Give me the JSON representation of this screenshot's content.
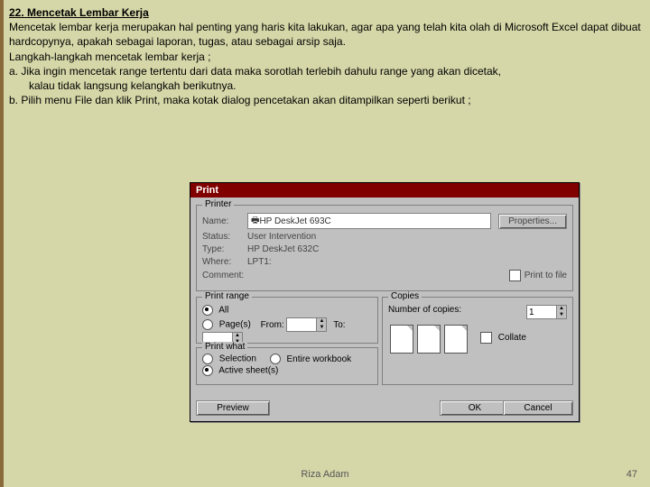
{
  "doc": {
    "heading": "22. Mencetak Lembar Kerja",
    "p1": "Mencetak lembar kerja merupakan hal penting yang haris kita lakukan, agar apa yang telah kita olah di Microsoft Excel dapat dibuat hardcopynya, apakah sebagai laporan, tugas, atau sebagai arsip saja.",
    "p2": "Langkah-langkah mencetak lembar kerja ;",
    "p3": "a. Jika ingin mencetak range tertentu dari data maka sorotlah terlebih dahulu range yang akan dicetak,",
    "p3b": "kalau tidak langsung kelangkah berikutnya.",
    "p4": "b. Pilih menu File dan klik Print, maka kotak dialog pencetakan akan ditampilkan seperti berikut ;"
  },
  "dialog": {
    "title": "Print",
    "printer": {
      "box": "Printer",
      "name_label": "Name:",
      "name_value": "HP DeskJet 693C",
      "status_label": "Status:",
      "status_value": "User Intervention",
      "type_label": "Type:",
      "type_value": "HP DeskJet 632C",
      "where_label": "Where:",
      "where_value": "LPT1:",
      "comment_label": "Comment:",
      "properties": "Properties...",
      "print_to_file": "Print to file"
    },
    "range": {
      "box": "Print range",
      "all": "All",
      "pages": "Page(s)",
      "from": "From:",
      "to": "To:"
    },
    "copies": {
      "box": "Copies",
      "num_label": "Number of copies:",
      "num_value": "1",
      "collate": "Collate"
    },
    "what": {
      "box": "Print what",
      "selection": "Selection",
      "workbook": "Entire workbook",
      "sheets": "Active sheet(s)"
    },
    "buttons": {
      "preview": "Preview",
      "ok": "OK",
      "cancel": "Cancel"
    }
  },
  "footer": {
    "author": "Riza Adam",
    "page": "47"
  }
}
